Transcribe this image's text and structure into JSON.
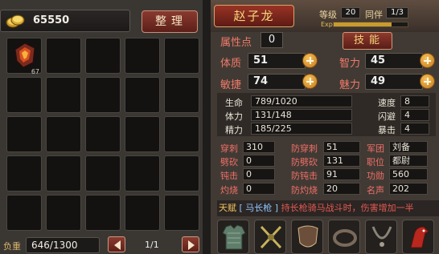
{
  "inventory": {
    "gold": "65550",
    "sort_label": "整理",
    "items": [
      {
        "icon": "fire-armor-icon",
        "count": "67"
      },
      {},
      {},
      {},
      {},
      {},
      {},
      {},
      {},
      {},
      {},
      {},
      {},
      {},
      {},
      {},
      {},
      {},
      {},
      {},
      {},
      {},
      {},
      {},
      {}
    ],
    "load_label": "负重",
    "load_value": "646/1300",
    "page": "1/1"
  },
  "character": {
    "name": "赵子龙",
    "level_label": "等级",
    "level": "20",
    "mate_label": "同伴",
    "mate": "1/3",
    "exp_label": "Exp",
    "exp_progress": 0.78,
    "attr_points_label": "属性点",
    "attr_points": "0",
    "skill_label": "技能",
    "stats": [
      {
        "label": "体质",
        "value": "51"
      },
      {
        "label": "智力",
        "value": "45"
      },
      {
        "label": "敏捷",
        "value": "74"
      },
      {
        "label": "魅力",
        "value": "49"
      }
    ],
    "info": {
      "hp_label": "生命",
      "hp": "789/1020",
      "stamina_label": "体力",
      "stamina": "131/148",
      "energy_label": "精力",
      "energy": "185/225",
      "speed_label": "速度",
      "speed": "8",
      "dodge_label": "闪避",
      "dodge": "4",
      "crit_label": "暴击",
      "crit": "4"
    },
    "combat": [
      {
        "label": "穿刺",
        "value": "310"
      },
      {
        "label": "防穿刺",
        "value": "51"
      },
      {
        "label": "军团",
        "value": "刘备"
      },
      {
        "label": "劈砍",
        "value": "0"
      },
      {
        "label": "防劈砍",
        "value": "131"
      },
      {
        "label": "职位",
        "value": "都尉"
      },
      {
        "label": "钝击",
        "value": "0"
      },
      {
        "label": "防钝击",
        "value": "91"
      },
      {
        "label": "功勋",
        "value": "560"
      },
      {
        "label": "灼烧",
        "value": "0"
      },
      {
        "label": "防灼烧",
        "value": "20"
      },
      {
        "label": "名声",
        "value": "202"
      }
    ],
    "talent_label": "天赋",
    "talent_name": "[ 马长枪 ]",
    "talent_desc": "持长枪骑马战斗时，伤害增加一半",
    "equipment": [
      {
        "icon": "chainmail-armor-icon"
      },
      {
        "icon": "shuriken-weapon-icon"
      },
      {
        "icon": "round-shield-icon"
      },
      {
        "icon": "leather-belt-icon"
      },
      {
        "icon": "necklace-icon"
      },
      {
        "icon": "red-horse-icon"
      }
    ]
  }
}
